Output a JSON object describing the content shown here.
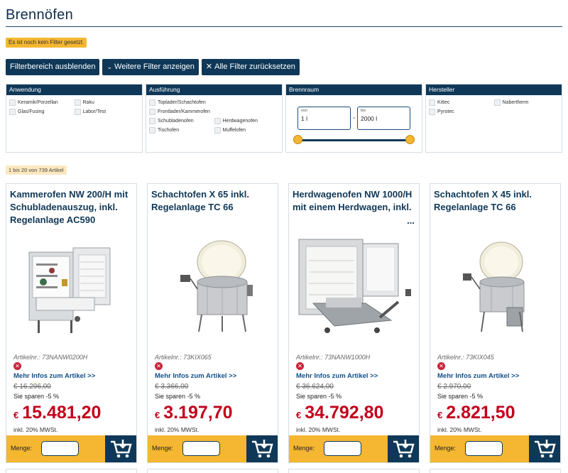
{
  "page": {
    "title": "Brennöfen"
  },
  "notice": "Es ist noch kein Filter gesetzt.",
  "buttons": {
    "hide_filters": "Filterbereich ausblenden",
    "more_filters": "Weitere Filter anzeigen",
    "reset_filters": "Alle Filter zurücksetzen"
  },
  "filters": {
    "anwendung": {
      "title": "Anwendung",
      "options": [
        "Keramik/Porzellan",
        "Raku",
        "Glas/Fusing",
        "Labor/Test"
      ]
    },
    "ausfuehrung": {
      "title": "Ausführung",
      "options": [
        "Toplader/Schachtofen",
        "",
        "Frontlader/Kammerofen",
        "",
        "Schubladenofen",
        "Herdwagenofen",
        "Tischofen",
        "Muffelofen"
      ]
    },
    "brennraum": {
      "title": "Brennraum",
      "from_label": "von",
      "from_value": "1 l",
      "to_label": "bis",
      "to_value": "2000 l",
      "separator": "-"
    },
    "hersteller": {
      "title": "Hersteller",
      "options": [
        "Kittec",
        "Nabertherm",
        "Pyrotec"
      ]
    }
  },
  "result_count": "1 bis 20 von 739 Artikel",
  "products": [
    {
      "title": "Kammerofen NW 200/H mit Schubladenauszug, inkl. Regelanlage AC590",
      "more": "",
      "artnr": "Artikelnr.: 73NANW0200H",
      "link": "Mehr Infos zum Artikel >>",
      "old_price": "€ 16.296,00",
      "save": "Sie sparen -5 %",
      "currency": "€",
      "price": "15.481,20",
      "vat": "inkl. 20% MWSt.",
      "qty_label": "Menge:"
    },
    {
      "title": "Schachtofen X 65 inkl. Regelanlage TC 66",
      "more": "",
      "artnr": "Artikelnr.: 73KIX065",
      "link": "Mehr Infos zum Artikel >>",
      "old_price": "€ 3.366,00",
      "save": "Sie sparen -5 %",
      "currency": "€",
      "price": "3.197,70",
      "vat": "inkl. 20% MWSt.",
      "qty_label": "Menge:"
    },
    {
      "title": "Herdwagenofen NW 1000/H mit einem Herdwagen, inkl.",
      "more": "...",
      "artnr": "Artikelnr.: 73NANW1000H",
      "link": "Mehr Infos zum Artikel >>",
      "old_price": "€ 36.624,00",
      "save": "Sie sparen -5 %",
      "currency": "€",
      "price": "34.792,80",
      "vat": "inkl. 20% MWSt.",
      "qty_label": "Menge:"
    },
    {
      "title": "Schachtofen X 45 inkl. Regelanlage TC 66",
      "more": "",
      "artnr": "Artikelnr.: 73KIX045",
      "link": "Mehr Infos zum Artikel >>",
      "old_price": "€ 2.970,00",
      "save": "Sie sparen -5 %",
      "currency": "€",
      "price": "2.821,50",
      "vat": "inkl. 20% MWSt.",
      "qty_label": "Menge:"
    }
  ],
  "colors": {
    "navy": "#0f3858",
    "accent": "#f5b731",
    "price": "#c3001c",
    "link": "#12508a"
  }
}
